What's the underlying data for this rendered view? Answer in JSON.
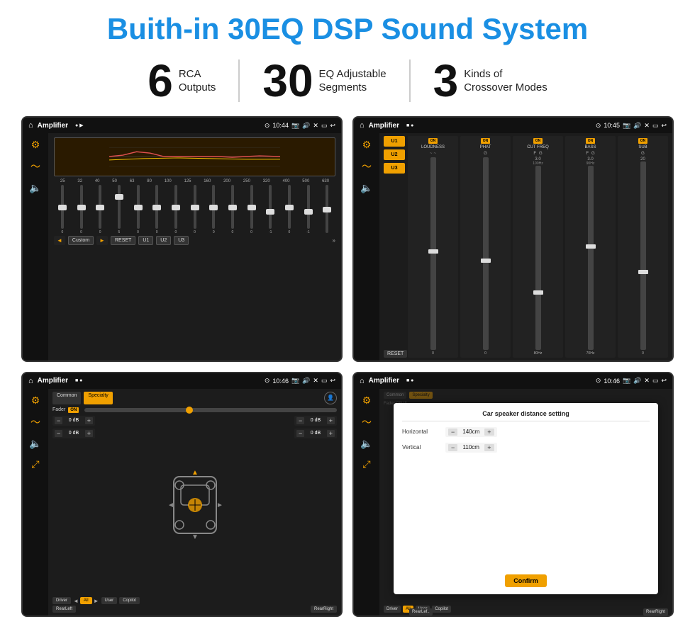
{
  "page": {
    "main_title": "Buith-in 30EQ DSP Sound System",
    "stats": [
      {
        "number": "6",
        "label_line1": "RCA",
        "label_line2": "Outputs"
      },
      {
        "number": "30",
        "label_line1": "EQ Adjustable",
        "label_line2": "Segments"
      },
      {
        "number": "3",
        "label_line1": "Kinds of",
        "label_line2": "Crossover Modes"
      }
    ],
    "screens": [
      {
        "id": "eq-screen",
        "title": "Amplifier",
        "time": "10:44",
        "type": "eq"
      },
      {
        "id": "amp-screen",
        "title": "Amplifier",
        "time": "10:45",
        "type": "amp"
      },
      {
        "id": "spk-screen",
        "title": "Amplifier",
        "time": "10:46",
        "type": "speaker"
      },
      {
        "id": "dlg-screen",
        "title": "Amplifier",
        "time": "10:46",
        "type": "dialog"
      }
    ],
    "eq": {
      "frequencies": [
        "25",
        "32",
        "40",
        "50",
        "63",
        "80",
        "100",
        "125",
        "160",
        "200",
        "250",
        "320",
        "400",
        "500",
        "630"
      ],
      "values": [
        "0",
        "0",
        "0",
        "5",
        "0",
        "0",
        "0",
        "0",
        "0",
        "0",
        "0",
        "-1",
        "0",
        "-1",
        ""
      ],
      "presets": [
        "Custom",
        "RESET",
        "U1",
        "U2",
        "U3"
      ]
    },
    "amp": {
      "presets": [
        "U1",
        "U2",
        "U3"
      ],
      "channels": [
        "LOUDNESS",
        "PHAT",
        "CUT FREQ",
        "BASS",
        "SUB"
      ],
      "reset_label": "RESET"
    },
    "speaker": {
      "tabs": [
        "Common",
        "Specialty"
      ],
      "fader_label": "Fader",
      "fader_on": "ON",
      "db_values": [
        "0 dB",
        "0 dB",
        "0 dB",
        "0 dB"
      ],
      "buttons": [
        "Driver",
        "All",
        "User",
        "Copilot",
        "RearLeft",
        "RearRight"
      ]
    },
    "dialog": {
      "title": "Car speaker distance setting",
      "horizontal_label": "Horizontal",
      "horizontal_value": "140cm",
      "vertical_label": "Vertical",
      "vertical_value": "110cm",
      "confirm_label": "Confirm",
      "bottom_buttons": [
        "RearLeft..",
        "All",
        "User",
        "RearRight"
      ]
    }
  }
}
